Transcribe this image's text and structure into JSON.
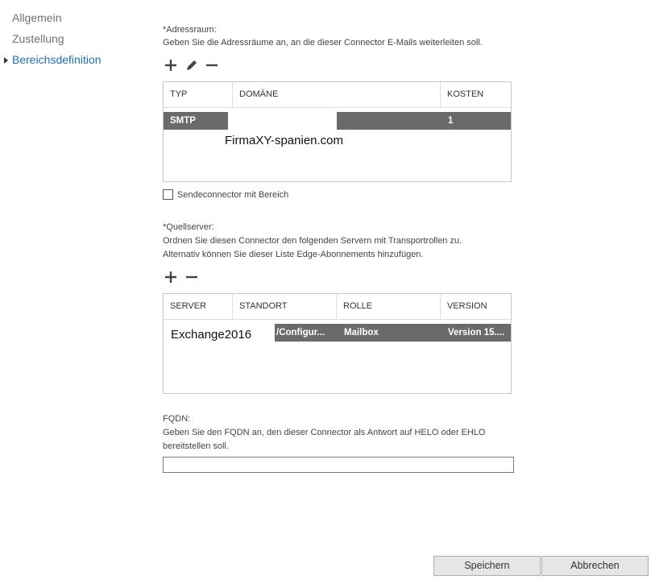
{
  "nav": {
    "items": [
      {
        "label": "Allgemein"
      },
      {
        "label": "Zustellung"
      },
      {
        "label": "Bereichsdefinition"
      }
    ]
  },
  "address_space": {
    "title": "*Adressraum:",
    "description": "Geben Sie die Adressräume an, an die dieser Connector E-Mails weiterleiten soll.",
    "icons": [
      "plus-icon",
      "pencil-icon",
      "minus-icon"
    ],
    "columns": [
      "TYP",
      "DOMÄNE",
      "KOSTEN"
    ],
    "rows": [
      {
        "type": "SMTP",
        "domain": "FirmaXY-spanien.com",
        "cost": "1"
      }
    ]
  },
  "scoped_connector": {
    "label": "Sendeconnector mit Bereich",
    "checked": false
  },
  "source_servers": {
    "title": "*Quellserver:",
    "description_line1": "Ordnen Sie diesen Connector den folgenden Servern mit Transportrollen zu.",
    "description_line2": "Alternativ können Sie dieser Liste Edge-Abonnements hinzufügen.",
    "icons": [
      "plus-icon",
      "minus-icon"
    ],
    "columns": [
      "SERVER",
      "STANDORT",
      "ROLLE",
      "VERSION"
    ],
    "rows": [
      {
        "server": "Exchange2016",
        "site": "/Configur...",
        "role": "Mailbox",
        "version": "Version 15...."
      }
    ]
  },
  "fqdn": {
    "title": "FQDN:",
    "description_line1": "Geben Sie den FQDN an, den dieser Connector als Antwort auf HELO oder EHLO",
    "description_line2": "bereitstellen soll.",
    "value": ""
  },
  "buttons": {
    "save": "Speichern",
    "cancel": "Abbrechen"
  }
}
